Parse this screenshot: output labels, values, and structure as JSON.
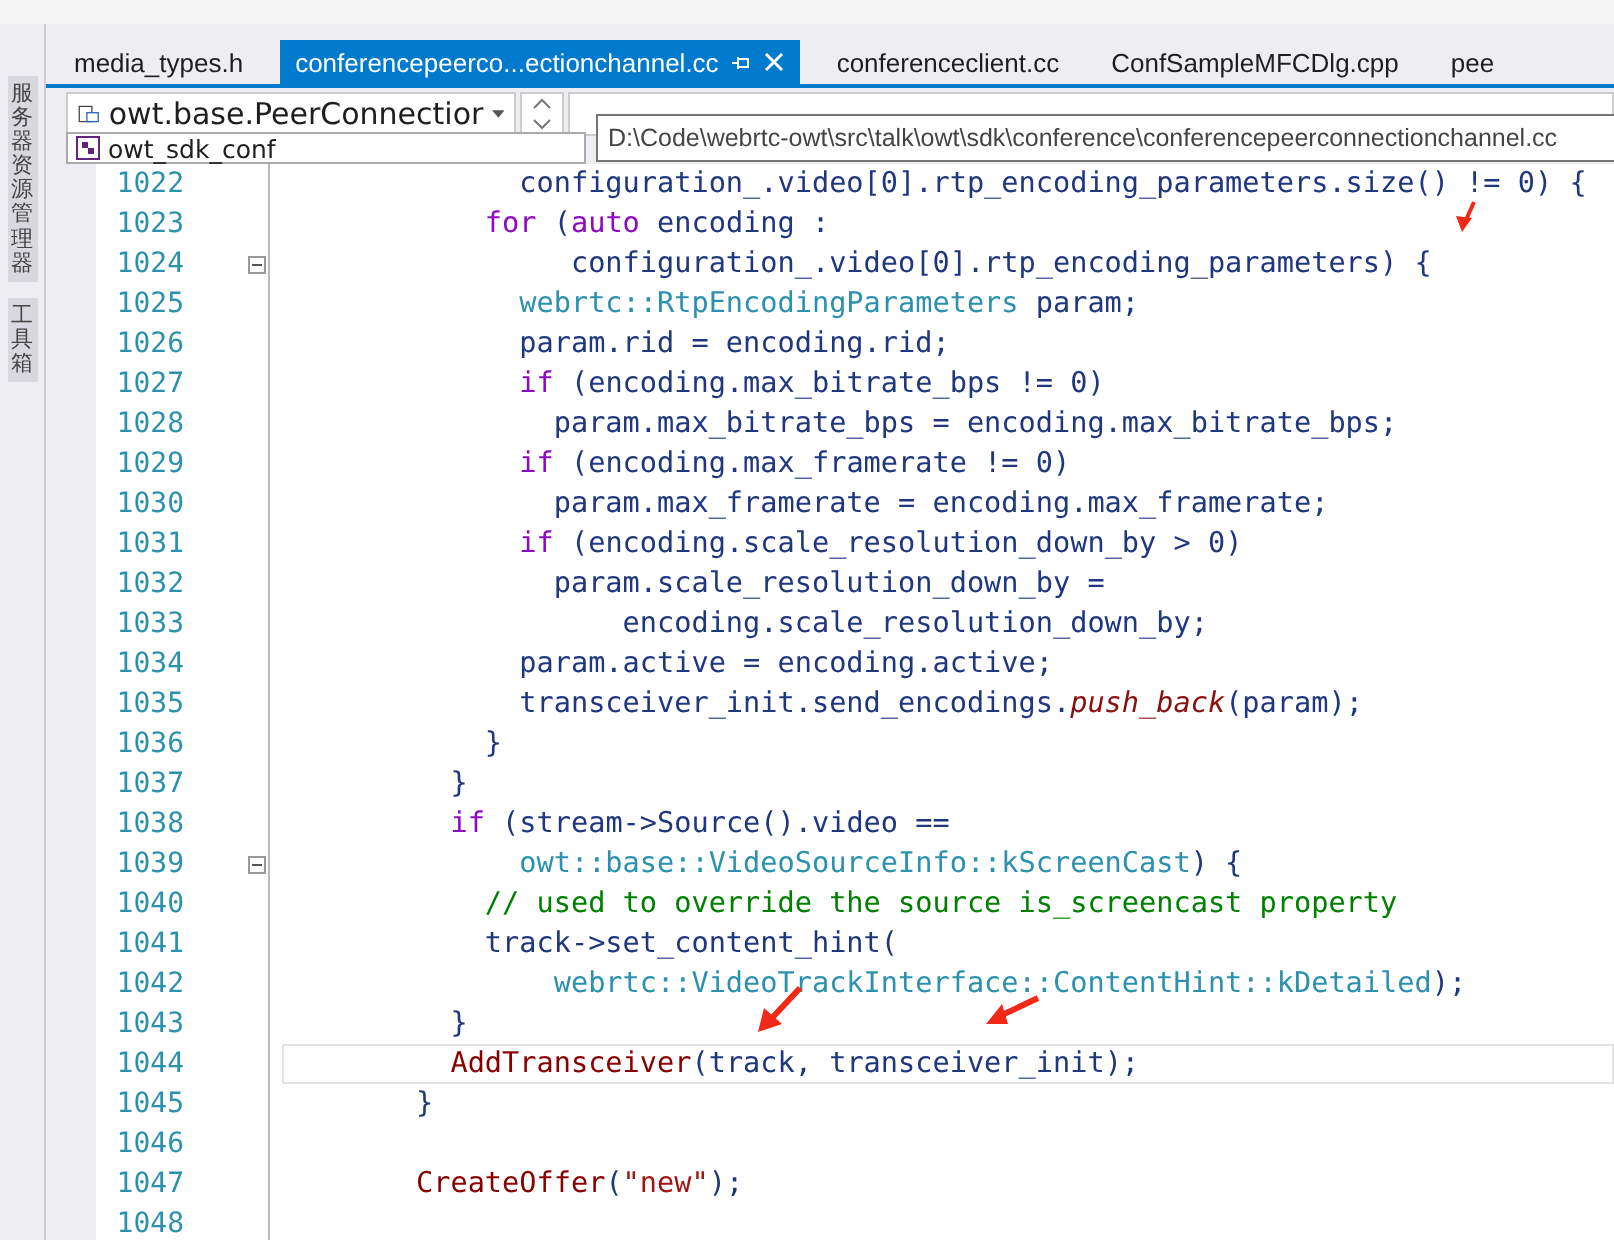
{
  "side_panel": {
    "tabs": [
      {
        "label": "服务器资源管理器"
      },
      {
        "label": "工具箱"
      }
    ]
  },
  "tabs": [
    {
      "label": "media_types.h",
      "selected": false
    },
    {
      "label": "conferencepeerco...ectionchannel.cc",
      "selected": true
    },
    {
      "label": "conferenceclient.cc",
      "selected": false
    },
    {
      "label": "ConfSampleMFCDlg.cpp",
      "selected": false
    },
    {
      "label": "pee",
      "selected": false
    }
  ],
  "navigation": {
    "scope": "owt.base.PeerConnectior",
    "project": "owt_sdk_conf",
    "tooltip": "D:\\Code\\webrtc-owt\\src\\talk\\owt\\sdk\\conference\\conferencepeerconnectionchannel.cc"
  },
  "lines": [
    {
      "number": "1022",
      "current": false,
      "fold_start": false,
      "tokens": [
        {
          "text": "      configuration_.video[0].rtp_encoding_parameters.size() != 0) {",
          "kind": "plain"
        }
      ]
    },
    {
      "number": "1023",
      "current": false,
      "fold_start": false,
      "tokens": [
        {
          "text": "    for",
          "kind": "keyword"
        },
        {
          "text": " (",
          "kind": "plain"
        },
        {
          "text": "auto",
          "kind": "keyword"
        },
        {
          "text": " encoding :",
          "kind": "plain"
        }
      ]
    },
    {
      "number": "1024",
      "current": false,
      "fold_start": true,
      "tokens": [
        {
          "text": "         configuration_.video[0].rtp_encoding_parameters) {",
          "kind": "plain"
        }
      ]
    },
    {
      "number": "1025",
      "current": false,
      "fold_start": false,
      "tokens": [
        {
          "text": "      webrtc::RtpEncodingParameters",
          "kind": "type"
        },
        {
          "text": " param;",
          "kind": "plain"
        }
      ]
    },
    {
      "number": "1026",
      "current": false,
      "fold_start": false,
      "tokens": [
        {
          "text": "      param.rid = encoding.rid;",
          "kind": "plain"
        }
      ]
    },
    {
      "number": "1027",
      "current": false,
      "fold_start": false,
      "tokens": [
        {
          "text": "      if",
          "kind": "keyword"
        },
        {
          "text": " (encoding.max_bitrate_bps != 0)",
          "kind": "plain"
        }
      ]
    },
    {
      "number": "1028",
      "current": false,
      "fold_start": false,
      "tokens": [
        {
          "text": "        param.max_bitrate_bps = encoding.max_bitrate_bps;",
          "kind": "plain"
        }
      ]
    },
    {
      "number": "1029",
      "current": false,
      "fold_start": false,
      "tokens": [
        {
          "text": "      if",
          "kind": "keyword"
        },
        {
          "text": " (encoding.max_framerate != 0)",
          "kind": "plain"
        }
      ]
    },
    {
      "number": "1030",
      "current": false,
      "fold_start": false,
      "tokens": [
        {
          "text": "        param.max_framerate = encoding.max_framerate;",
          "kind": "plain"
        }
      ]
    },
    {
      "number": "1031",
      "current": false,
      "fold_start": false,
      "tokens": [
        {
          "text": "      if",
          "kind": "keyword"
        },
        {
          "text": " (encoding.scale_resolution_down_by > 0)",
          "kind": "plain"
        }
      ]
    },
    {
      "number": "1032",
      "current": false,
      "fold_start": false,
      "tokens": [
        {
          "text": "        param.scale_resolution_down_by =",
          "kind": "plain"
        }
      ]
    },
    {
      "number": "1033",
      "current": false,
      "fold_start": false,
      "tokens": [
        {
          "text": "            encoding.scale_resolution_down_by;",
          "kind": "plain"
        }
      ]
    },
    {
      "number": "1034",
      "current": false,
      "fold_start": false,
      "tokens": [
        {
          "text": "      param.active = encoding.active;",
          "kind": "plain"
        }
      ]
    },
    {
      "number": "1035",
      "current": false,
      "fold_start": false,
      "tokens": [
        {
          "text": "      transceiver_init.send_encodings.",
          "kind": "plain"
        },
        {
          "text": "push_back",
          "kind": "method"
        },
        {
          "text": "(param);",
          "kind": "plain"
        }
      ]
    },
    {
      "number": "1036",
      "current": false,
      "fold_start": false,
      "tokens": [
        {
          "text": "    }",
          "kind": "plain"
        }
      ]
    },
    {
      "number": "1037",
      "current": false,
      "fold_start": false,
      "tokens": [
        {
          "text": "  }",
          "kind": "plain"
        }
      ]
    },
    {
      "number": "1038",
      "current": false,
      "fold_start": false,
      "tokens": [
        {
          "text": "  if",
          "kind": "keyword"
        },
        {
          "text": " (stream->Source().video ==",
          "kind": "plain"
        }
      ]
    },
    {
      "number": "1039",
      "current": false,
      "fold_start": true,
      "tokens": [
        {
          "text": "      owt::base::VideoSourceInfo::kScreenCast",
          "kind": "type"
        },
        {
          "text": ") {",
          "kind": "plain"
        }
      ]
    },
    {
      "number": "1040",
      "current": false,
      "fold_start": false,
      "tokens": [
        {
          "text": "    // used to override the source is_screencast property",
          "kind": "comment"
        }
      ]
    },
    {
      "number": "1041",
      "current": false,
      "fold_start": false,
      "tokens": [
        {
          "text": "    track->set_content_hint(",
          "kind": "plain"
        }
      ]
    },
    {
      "number": "1042",
      "current": false,
      "fold_start": false,
      "tokens": [
        {
          "text": "        webrtc::VideoTrackInterface::ContentHint::kDetailed",
          "kind": "type"
        },
        {
          "text": ");",
          "kind": "plain"
        }
      ]
    },
    {
      "number": "1043",
      "current": false,
      "fold_start": false,
      "tokens": [
        {
          "text": "  }",
          "kind": "plain"
        }
      ]
    },
    {
      "number": "1044",
      "current": true,
      "fold_start": false,
      "tokens": [
        {
          "text": "  AddTransceiver",
          "kind": "function"
        },
        {
          "text": "(track, transceiver_init);",
          "kind": "plain"
        }
      ]
    },
    {
      "number": "1045",
      "current": false,
      "fold_start": false,
      "tokens": [
        {
          "text": "}",
          "kind": "plain"
        }
      ]
    },
    {
      "number": "1046",
      "current": false,
      "fold_start": false
    },
    {
      "number": "1047",
      "current": false,
      "fold_start": false,
      "tokens": [
        {
          "text": "CreateOffer",
          "kind": "function"
        },
        {
          "text": "(",
          "kind": "plain"
        },
        {
          "text": "\"new\"",
          "kind": "string"
        },
        {
          "text": ");",
          "kind": "plain"
        }
      ]
    },
    {
      "number": "1048",
      "current": false,
      "fold_start": false
    }
  ]
}
